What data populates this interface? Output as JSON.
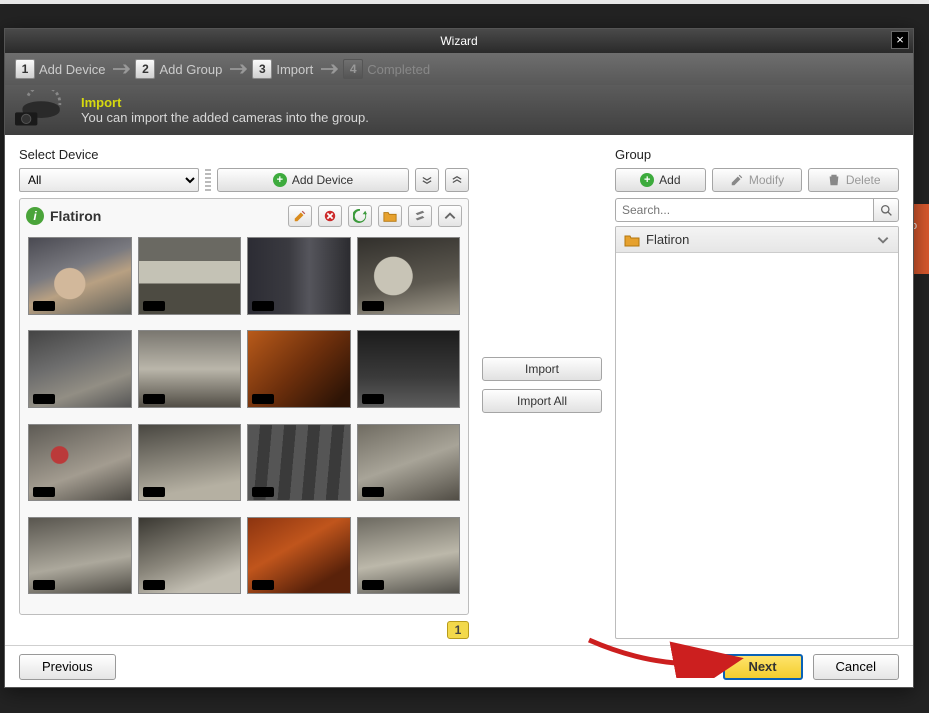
{
  "window": {
    "title": "Wizard"
  },
  "steps": {
    "s1": {
      "num": "1",
      "label": "Add Device"
    },
    "s2": {
      "num": "2",
      "label": "Add Group"
    },
    "s3": {
      "num": "3",
      "label": "Import"
    },
    "s4": {
      "num": "4",
      "label": "Completed"
    }
  },
  "banner": {
    "title": "Import",
    "desc": "You can import the added cameras into the group."
  },
  "device": {
    "section_label": "Select Device",
    "filter_value": "All",
    "add_device_label": "Add Device",
    "panel_name": "Flatiron",
    "page_current": "1"
  },
  "middle": {
    "import_label": "Import",
    "import_all_label": "Import All"
  },
  "group": {
    "section_label": "Group",
    "add_label": "Add",
    "modify_label": "Modify",
    "delete_label": "Delete",
    "search_placeholder": "Search...",
    "node_name": "Flatiron"
  },
  "footer": {
    "prev_label": "Previous",
    "next_label": "Next",
    "cancel_label": "Cancel"
  }
}
